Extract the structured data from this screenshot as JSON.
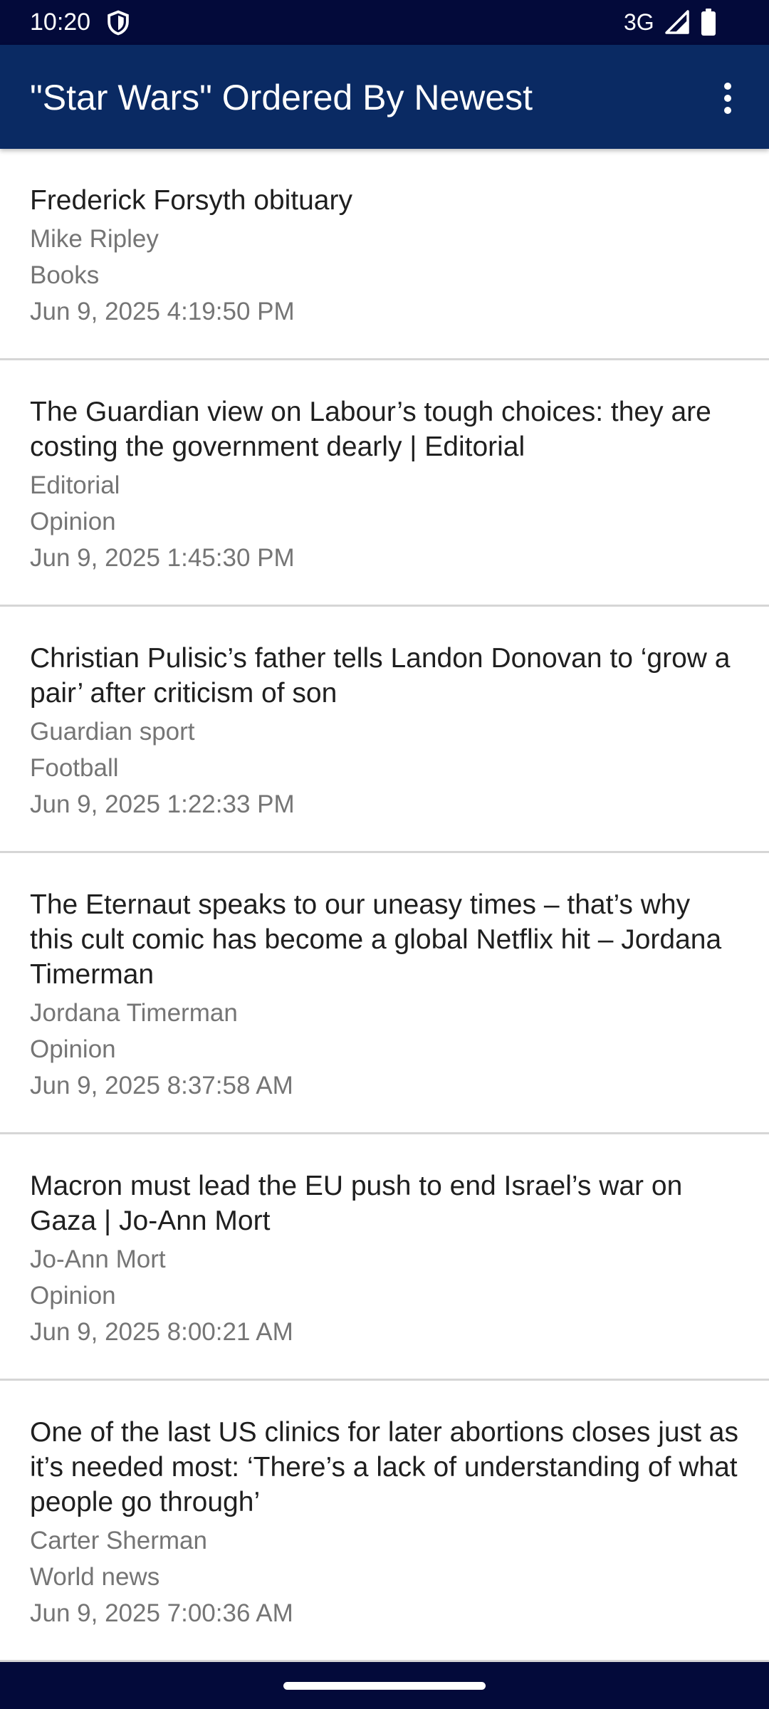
{
  "status_bar": {
    "time": "10:20",
    "network": "3G",
    "icons": [
      "shield-icon",
      "signal-icon",
      "battery-icon"
    ]
  },
  "app_bar": {
    "title": "\"Star Wars\" Ordered By Newest",
    "menu_icon": "more-vert-icon"
  },
  "articles": [
    {
      "title": "Frederick Forsyth obituary",
      "author": "Mike Ripley",
      "section": "Books",
      "date": "Jun 9, 2025 4:19:50 PM"
    },
    {
      "title": "The Guardian view on Labour’s tough choices: they are costing the government dearly | Editorial",
      "author": "Editorial",
      "section": "Opinion",
      "date": "Jun 9, 2025 1:45:30 PM"
    },
    {
      "title": "Christian Pulisic’s father tells Landon Donovan to ‘grow a pair’ after criticism of son",
      "author": "Guardian sport",
      "section": "Football",
      "date": "Jun 9, 2025 1:22:33 PM"
    },
    {
      "title": "The Eternaut speaks to our uneasy times – that’s why this cult comic has become a global Netflix hit – Jordana Timerman",
      "author": "Jordana Timerman",
      "section": "Opinion",
      "date": "Jun 9, 2025 8:37:58 AM"
    },
    {
      "title": "Macron must lead the EU push to end Israel’s war on Gaza | Jo-Ann Mort",
      "author": "Jo-Ann Mort",
      "section": "Opinion",
      "date": "Jun 9, 2025 8:00:21 AM"
    },
    {
      "title": "One of the last US clinics for later abortions closes just as it’s needed most: ‘There’s a lack of understanding of what people go through’",
      "author": "Carter Sherman",
      "section": "World news",
      "date": "Jun 9, 2025 7:00:36 AM"
    }
  ],
  "colors": {
    "status_bar": "#030a3a",
    "app_bar": "#0a2a63",
    "title_text": "#1f1f1f",
    "meta_text": "#757575",
    "divider": "#d6d6d6"
  }
}
